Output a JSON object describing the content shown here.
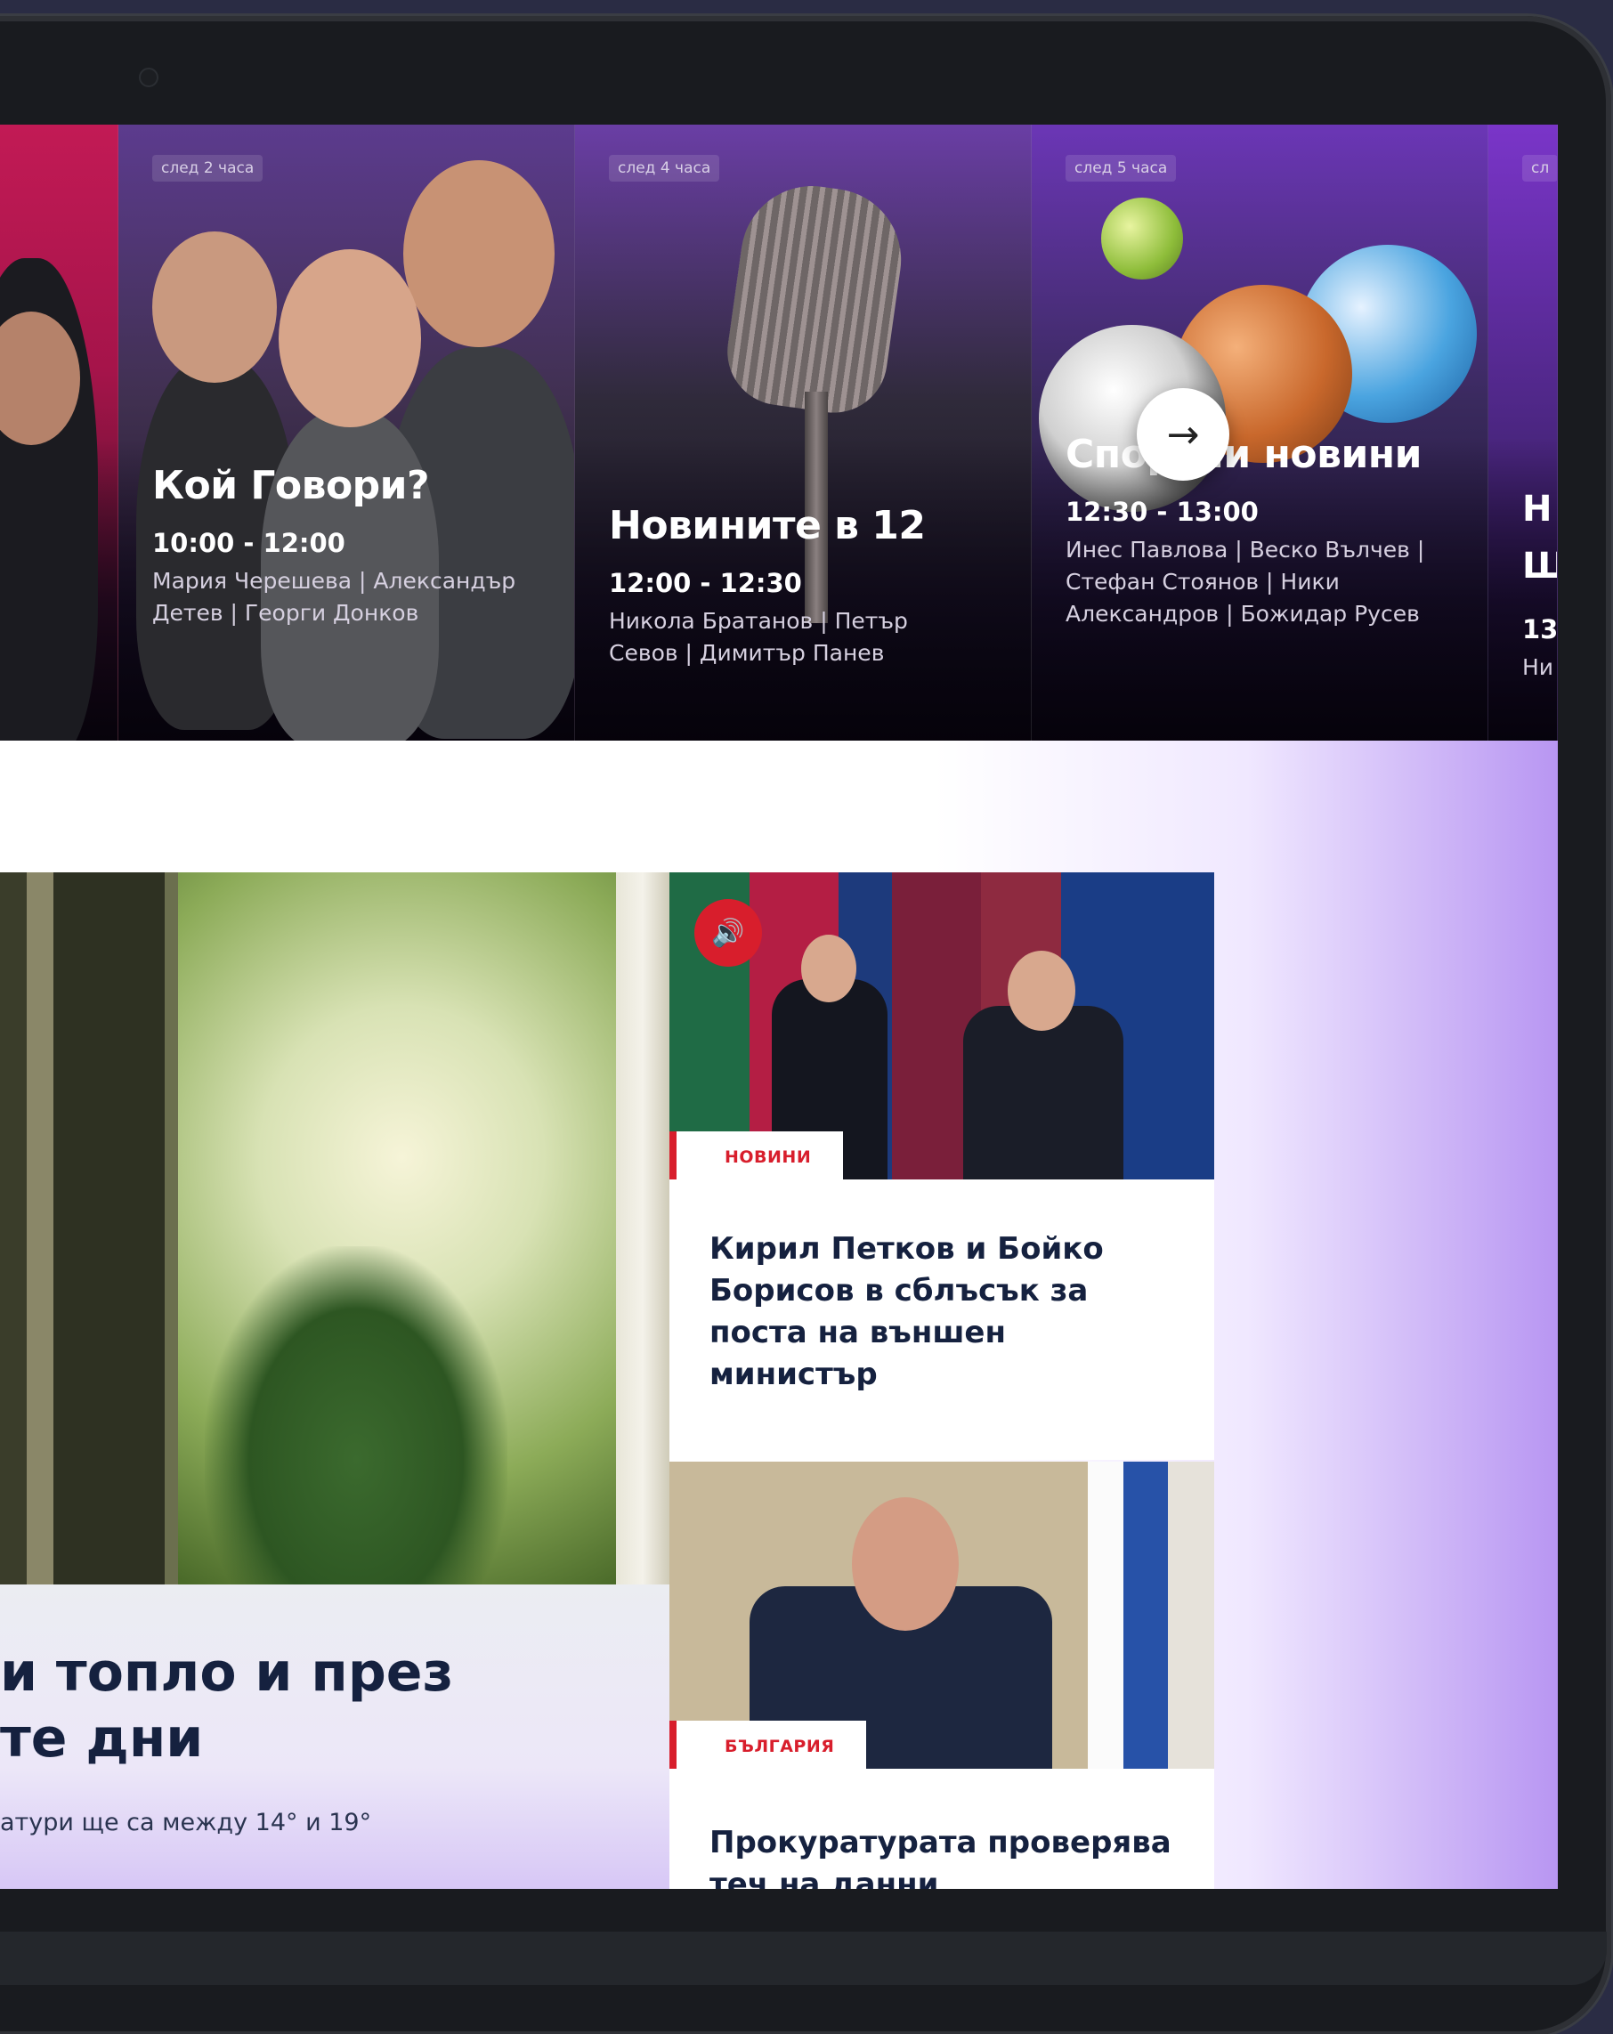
{
  "schedule": [
    {
      "badge": "",
      "title": "",
      "time": "",
      "hosts": ""
    },
    {
      "badge": "след 2 часа",
      "title": "Кой Говори?",
      "time": "10:00 - 12:00",
      "hosts": "Мария Черешева | Александър Детев | Георги Донков"
    },
    {
      "badge": "след 4 часа",
      "title": "Новините в 12",
      "time": "12:00 - 12:30",
      "hosts": "Никола Братанов | Петър Севов | Димитър Панев"
    },
    {
      "badge": "след 5 часа",
      "title": "Спортни новини",
      "time": "12:30 - 13:00",
      "hosts": "Инес Павлова | Веско Вълчев | Стефан Стоянов | Ники Александров | Божидар Русев"
    },
    {
      "badge": "сл",
      "title": "Н Ш",
      "time": "13:",
      "hosts": "Ни"
    }
  ],
  "next_button_icon": "arrow-right-icon",
  "hero": {
    "headline_line1": "и топло и през",
    "headline_line2": "те дни",
    "subtitle": "атури ще са между 14° и 19°"
  },
  "news": [
    {
      "category": "НОВИНИ",
      "title": "Кирил Петков и Бойко Борисов в сблъсък за поста на външен министър",
      "audio_icon": "speaker-icon"
    },
    {
      "category": "БЪЛГАРИЯ",
      "title": "Прокуратурата проверява теч на данни"
    }
  ],
  "colors": {
    "accent_red": "#d81e2c",
    "navy_text": "#15213f",
    "schedule_purple": "#6b36b6",
    "device_frame": "#191b1f"
  }
}
